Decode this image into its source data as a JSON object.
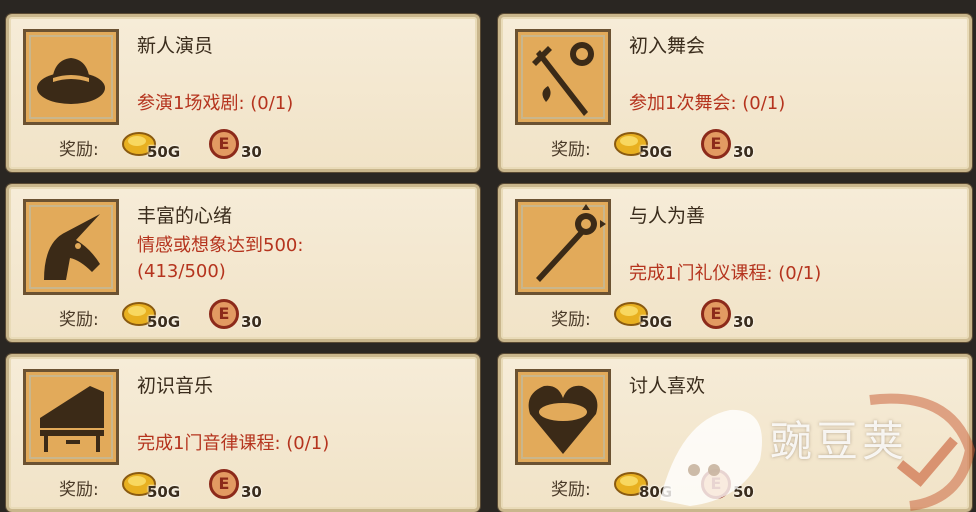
{
  "reward_label": "奖励:",
  "quests": [
    {
      "title": "新人演员",
      "progress": [
        "参演1场戏剧: (0/1)"
      ],
      "gold": "50G",
      "e": "30",
      "icon": "hat-icon"
    },
    {
      "title": "初入舞会",
      "progress": [
        "参加1次舞会: (0/1)"
      ],
      "gold": "50G",
      "e": "30",
      "icon": "sword-rose-icon"
    },
    {
      "title": "丰富的心绪",
      "progress": [
        "情感或想象达到500:",
        "(413/500)"
      ],
      "gold": "50G",
      "e": "30",
      "icon": "unicorn-icon"
    },
    {
      "title": "与人为善",
      "progress": [
        "完成1门礼仪课程: (0/1)"
      ],
      "gold": "50G",
      "e": "30",
      "icon": "scepter-icon"
    },
    {
      "title": "初识音乐",
      "progress": [
        "完成1门音律课程: (0/1)"
      ],
      "gold": "50G",
      "e": "30",
      "icon": "piano-icon"
    },
    {
      "title": "讨人喜欢",
      "progress": [],
      "gold": "80G",
      "e": "50",
      "icon": "heart-icon"
    }
  ],
  "currency": {
    "e_symbol": "E"
  },
  "watermark": {
    "text": "豌豆荚"
  },
  "colors": {
    "card_bg": "#f4e8d0",
    "icon_bg": "#e2aa5a",
    "progress_red": "#b5341e",
    "title": "#3a2c1c"
  }
}
